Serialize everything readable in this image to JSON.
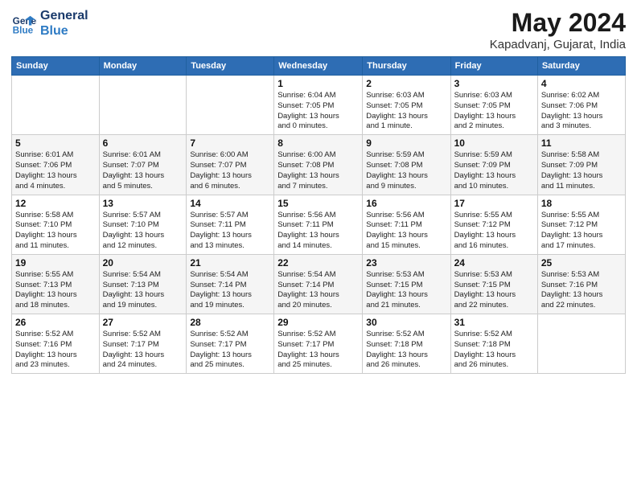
{
  "logo": {
    "line1": "General",
    "line2": "Blue"
  },
  "title": "May 2024",
  "location": "Kapadvanj, Gujarat, India",
  "days_header": [
    "Sunday",
    "Monday",
    "Tuesday",
    "Wednesday",
    "Thursday",
    "Friday",
    "Saturday"
  ],
  "weeks": [
    [
      {
        "num": "",
        "info": ""
      },
      {
        "num": "",
        "info": ""
      },
      {
        "num": "",
        "info": ""
      },
      {
        "num": "1",
        "info": "Sunrise: 6:04 AM\nSunset: 7:05 PM\nDaylight: 13 hours\nand 0 minutes."
      },
      {
        "num": "2",
        "info": "Sunrise: 6:03 AM\nSunset: 7:05 PM\nDaylight: 13 hours\nand 1 minute."
      },
      {
        "num": "3",
        "info": "Sunrise: 6:03 AM\nSunset: 7:05 PM\nDaylight: 13 hours\nand 2 minutes."
      },
      {
        "num": "4",
        "info": "Sunrise: 6:02 AM\nSunset: 7:06 PM\nDaylight: 13 hours\nand 3 minutes."
      }
    ],
    [
      {
        "num": "5",
        "info": "Sunrise: 6:01 AM\nSunset: 7:06 PM\nDaylight: 13 hours\nand 4 minutes."
      },
      {
        "num": "6",
        "info": "Sunrise: 6:01 AM\nSunset: 7:07 PM\nDaylight: 13 hours\nand 5 minutes."
      },
      {
        "num": "7",
        "info": "Sunrise: 6:00 AM\nSunset: 7:07 PM\nDaylight: 13 hours\nand 6 minutes."
      },
      {
        "num": "8",
        "info": "Sunrise: 6:00 AM\nSunset: 7:08 PM\nDaylight: 13 hours\nand 7 minutes."
      },
      {
        "num": "9",
        "info": "Sunrise: 5:59 AM\nSunset: 7:08 PM\nDaylight: 13 hours\nand 9 minutes."
      },
      {
        "num": "10",
        "info": "Sunrise: 5:59 AM\nSunset: 7:09 PM\nDaylight: 13 hours\nand 10 minutes."
      },
      {
        "num": "11",
        "info": "Sunrise: 5:58 AM\nSunset: 7:09 PM\nDaylight: 13 hours\nand 11 minutes."
      }
    ],
    [
      {
        "num": "12",
        "info": "Sunrise: 5:58 AM\nSunset: 7:10 PM\nDaylight: 13 hours\nand 11 minutes."
      },
      {
        "num": "13",
        "info": "Sunrise: 5:57 AM\nSunset: 7:10 PM\nDaylight: 13 hours\nand 12 minutes."
      },
      {
        "num": "14",
        "info": "Sunrise: 5:57 AM\nSunset: 7:11 PM\nDaylight: 13 hours\nand 13 minutes."
      },
      {
        "num": "15",
        "info": "Sunrise: 5:56 AM\nSunset: 7:11 PM\nDaylight: 13 hours\nand 14 minutes."
      },
      {
        "num": "16",
        "info": "Sunrise: 5:56 AM\nSunset: 7:11 PM\nDaylight: 13 hours\nand 15 minutes."
      },
      {
        "num": "17",
        "info": "Sunrise: 5:55 AM\nSunset: 7:12 PM\nDaylight: 13 hours\nand 16 minutes."
      },
      {
        "num": "18",
        "info": "Sunrise: 5:55 AM\nSunset: 7:12 PM\nDaylight: 13 hours\nand 17 minutes."
      }
    ],
    [
      {
        "num": "19",
        "info": "Sunrise: 5:55 AM\nSunset: 7:13 PM\nDaylight: 13 hours\nand 18 minutes."
      },
      {
        "num": "20",
        "info": "Sunrise: 5:54 AM\nSunset: 7:13 PM\nDaylight: 13 hours\nand 19 minutes."
      },
      {
        "num": "21",
        "info": "Sunrise: 5:54 AM\nSunset: 7:14 PM\nDaylight: 13 hours\nand 19 minutes."
      },
      {
        "num": "22",
        "info": "Sunrise: 5:54 AM\nSunset: 7:14 PM\nDaylight: 13 hours\nand 20 minutes."
      },
      {
        "num": "23",
        "info": "Sunrise: 5:53 AM\nSunset: 7:15 PM\nDaylight: 13 hours\nand 21 minutes."
      },
      {
        "num": "24",
        "info": "Sunrise: 5:53 AM\nSunset: 7:15 PM\nDaylight: 13 hours\nand 22 minutes."
      },
      {
        "num": "25",
        "info": "Sunrise: 5:53 AM\nSunset: 7:16 PM\nDaylight: 13 hours\nand 22 minutes."
      }
    ],
    [
      {
        "num": "26",
        "info": "Sunrise: 5:52 AM\nSunset: 7:16 PM\nDaylight: 13 hours\nand 23 minutes."
      },
      {
        "num": "27",
        "info": "Sunrise: 5:52 AM\nSunset: 7:17 PM\nDaylight: 13 hours\nand 24 minutes."
      },
      {
        "num": "28",
        "info": "Sunrise: 5:52 AM\nSunset: 7:17 PM\nDaylight: 13 hours\nand 25 minutes."
      },
      {
        "num": "29",
        "info": "Sunrise: 5:52 AM\nSunset: 7:17 PM\nDaylight: 13 hours\nand 25 minutes."
      },
      {
        "num": "30",
        "info": "Sunrise: 5:52 AM\nSunset: 7:18 PM\nDaylight: 13 hours\nand 26 minutes."
      },
      {
        "num": "31",
        "info": "Sunrise: 5:52 AM\nSunset: 7:18 PM\nDaylight: 13 hours\nand 26 minutes."
      },
      {
        "num": "",
        "info": ""
      }
    ]
  ]
}
